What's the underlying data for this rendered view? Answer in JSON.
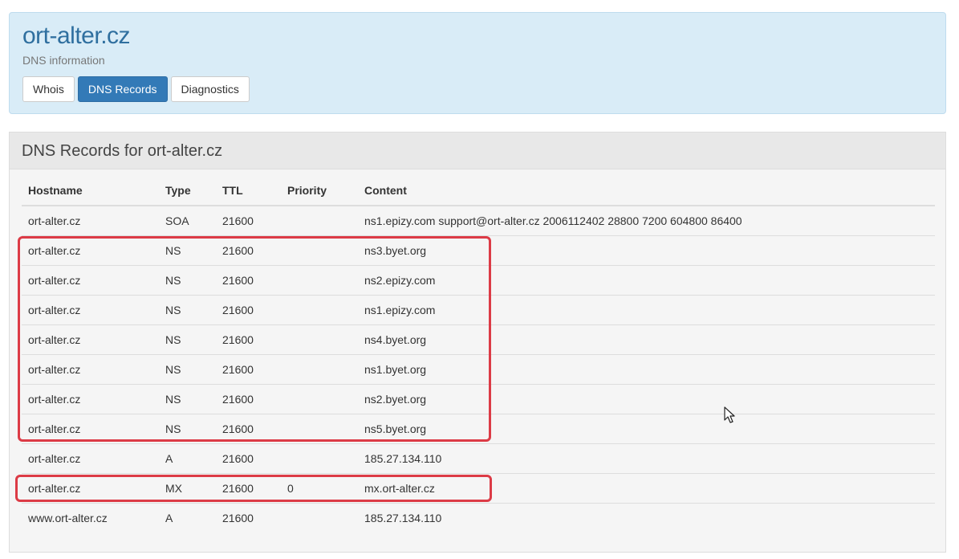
{
  "header": {
    "title": "ort-alter.cz",
    "subtitle": "DNS information",
    "tabs": [
      {
        "label": "Whois",
        "active": false
      },
      {
        "label": "DNS Records",
        "active": true
      },
      {
        "label": "Diagnostics",
        "active": false
      }
    ]
  },
  "panel": {
    "title": "DNS Records for ort-alter.cz"
  },
  "table": {
    "columns": [
      "Hostname",
      "Type",
      "TTL",
      "Priority",
      "Content"
    ],
    "rows": [
      {
        "hostname": "ort-alter.cz",
        "type": "SOA",
        "ttl": "21600",
        "priority": "",
        "content": "ns1.epizy.com support@ort-alter.cz 2006112402 28800 7200 604800 86400"
      },
      {
        "hostname": "ort-alter.cz",
        "type": "NS",
        "ttl": "21600",
        "priority": "",
        "content": "ns3.byet.org"
      },
      {
        "hostname": "ort-alter.cz",
        "type": "NS",
        "ttl": "21600",
        "priority": "",
        "content": "ns2.epizy.com"
      },
      {
        "hostname": "ort-alter.cz",
        "type": "NS",
        "ttl": "21600",
        "priority": "",
        "content": "ns1.epizy.com"
      },
      {
        "hostname": "ort-alter.cz",
        "type": "NS",
        "ttl": "21600",
        "priority": "",
        "content": "ns4.byet.org"
      },
      {
        "hostname": "ort-alter.cz",
        "type": "NS",
        "ttl": "21600",
        "priority": "",
        "content": "ns1.byet.org"
      },
      {
        "hostname": "ort-alter.cz",
        "type": "NS",
        "ttl": "21600",
        "priority": "",
        "content": "ns2.byet.org"
      },
      {
        "hostname": "ort-alter.cz",
        "type": "NS",
        "ttl": "21600",
        "priority": "",
        "content": "ns5.byet.org"
      },
      {
        "hostname": "ort-alter.cz",
        "type": "A",
        "ttl": "21600",
        "priority": "",
        "content": "185.27.134.110"
      },
      {
        "hostname": "ort-alter.cz",
        "type": "MX",
        "ttl": "21600",
        "priority": "0",
        "content": "mx.ort-alter.cz"
      },
      {
        "hostname": "www.ort-alter.cz",
        "type": "A",
        "ttl": "21600",
        "priority": "",
        "content": "185.27.134.110"
      }
    ]
  },
  "annotations": {
    "highlight_color": "#dc3b46",
    "highlights": [
      "ns-records-group",
      "mx-record"
    ]
  },
  "colors": {
    "header_bg": "#d9ecf7",
    "title": "#2f6f9f",
    "active_tab": "#337ab7"
  },
  "icons": [
    "mouse-cursor-icon"
  ]
}
